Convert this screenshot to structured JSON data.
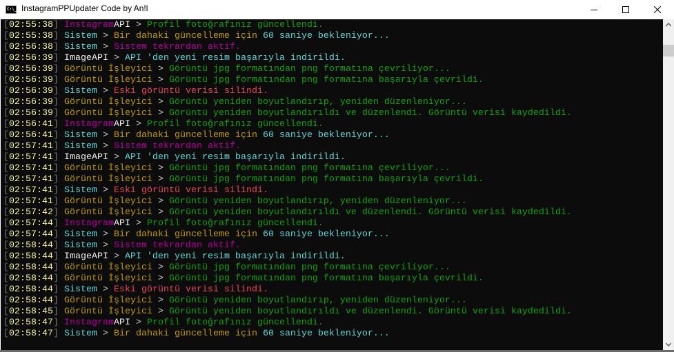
{
  "window": {
    "title": "InstagramPPUpdater Code by An!l",
    "icon_text": "C:\\_"
  },
  "colors": {
    "mag": "#b4009e",
    "wht": "#f2f2f2",
    "gry": "#cccccc",
    "grn": "#13a10e",
    "cyn": "#61d6d6",
    "yel": "#c19c00",
    "red": "#e74856"
  },
  "log": [
    {
      "time": "02:55:38",
      "segs": [
        {
          "text": "Instagram",
          "color": "mag"
        },
        {
          "text": "API",
          "color": "wht"
        },
        {
          "text": " > ",
          "color": "gry"
        },
        {
          "text": "Profil fotoğrafınız güncellendi.",
          "color": "grn"
        }
      ]
    },
    {
      "time": "02:55:38",
      "segs": [
        {
          "text": "Sistem",
          "color": "cyn"
        },
        {
          "text": " > ",
          "color": "gry"
        },
        {
          "text": "Bir dahaki güncelleme için ",
          "color": "yel"
        },
        {
          "text": "60 saniye bekleniyor...",
          "color": "cyn"
        }
      ]
    },
    {
      "time": "02:56:38",
      "segs": [
        {
          "text": "Sistem",
          "color": "cyn"
        },
        {
          "text": " > ",
          "color": "gry"
        },
        {
          "text": "Sistem tekrardan aktif.",
          "color": "mag"
        }
      ]
    },
    {
      "time": "02:56:39",
      "segs": [
        {
          "text": "ImageAPI",
          "color": "wht"
        },
        {
          "text": " > ",
          "color": "gry"
        },
        {
          "text": "API 'den yeni resim başarıyla indirildi.",
          "color": "cyn"
        }
      ]
    },
    {
      "time": "02:56:39",
      "segs": [
        {
          "text": "Görüntü İşleyici",
          "color": "yel"
        },
        {
          "text": " > ",
          "color": "gry"
        },
        {
          "text": "Görüntü jpg formatından png formatına çevriliyor...",
          "color": "grn"
        }
      ]
    },
    {
      "time": "02:56:39",
      "segs": [
        {
          "text": "Görüntü İşleyici",
          "color": "yel"
        },
        {
          "text": " > ",
          "color": "gry"
        },
        {
          "text": "Görüntü jpg formatından png formatına başarıyla çevrildi.",
          "color": "grn"
        }
      ]
    },
    {
      "time": "02:56:39",
      "segs": [
        {
          "text": "Sistem",
          "color": "cyn"
        },
        {
          "text": " > ",
          "color": "gry"
        },
        {
          "text": "Eski görüntü verisi silindi.",
          "color": "red"
        }
      ]
    },
    {
      "time": "02:56:39",
      "segs": [
        {
          "text": "Görüntü İşleyici",
          "color": "yel"
        },
        {
          "text": " > ",
          "color": "gry"
        },
        {
          "text": "Görüntü yeniden boyutlandırıp, yeniden düzenleniyor...",
          "color": "grn"
        }
      ]
    },
    {
      "time": "02:56:39",
      "segs": [
        {
          "text": "Görüntü İşleyici",
          "color": "yel"
        },
        {
          "text": " > ",
          "color": "gry"
        },
        {
          "text": "Görüntü yeniden boyutlandırıldı ve düzenlendi. Görüntü verisi kaydedildi.",
          "color": "grn"
        }
      ]
    },
    {
      "time": "02:56:41",
      "segs": [
        {
          "text": "Instagram",
          "color": "mag"
        },
        {
          "text": "API",
          "color": "wht"
        },
        {
          "text": " > ",
          "color": "gry"
        },
        {
          "text": "Profil fotoğrafınız güncellendi.",
          "color": "grn"
        }
      ]
    },
    {
      "time": "02:56:41",
      "segs": [
        {
          "text": "Sistem",
          "color": "cyn"
        },
        {
          "text": " > ",
          "color": "gry"
        },
        {
          "text": "Bir dahaki güncelleme için ",
          "color": "yel"
        },
        {
          "text": "60 saniye bekleniyor...",
          "color": "cyn"
        }
      ]
    },
    {
      "time": "02:57:41",
      "segs": [
        {
          "text": "Sistem",
          "color": "cyn"
        },
        {
          "text": " > ",
          "color": "gry"
        },
        {
          "text": "Sistem tekrardan aktif.",
          "color": "mag"
        }
      ]
    },
    {
      "time": "02:57:41",
      "segs": [
        {
          "text": "ImageAPI",
          "color": "wht"
        },
        {
          "text": " > ",
          "color": "gry"
        },
        {
          "text": "API 'den yeni resim başarıyla indirildi.",
          "color": "cyn"
        }
      ]
    },
    {
      "time": "02:57:41",
      "segs": [
        {
          "text": "Görüntü İşleyici",
          "color": "yel"
        },
        {
          "text": " > ",
          "color": "gry"
        },
        {
          "text": "Görüntü jpg formatından png formatına çevriliyor...",
          "color": "grn"
        }
      ]
    },
    {
      "time": "02:57:41",
      "segs": [
        {
          "text": "Görüntü İşleyici",
          "color": "yel"
        },
        {
          "text": " > ",
          "color": "gry"
        },
        {
          "text": "Görüntü jpg formatından png formatına başarıyla çevrildi.",
          "color": "grn"
        }
      ]
    },
    {
      "time": "02:57:41",
      "segs": [
        {
          "text": "Sistem",
          "color": "cyn"
        },
        {
          "text": " > ",
          "color": "gry"
        },
        {
          "text": "Eski görüntü verisi silindi.",
          "color": "red"
        }
      ]
    },
    {
      "time": "02:57:41",
      "segs": [
        {
          "text": "Görüntü İşleyici",
          "color": "yel"
        },
        {
          "text": " > ",
          "color": "gry"
        },
        {
          "text": "Görüntü yeniden boyutlandırıp, yeniden düzenleniyor...",
          "color": "grn"
        }
      ]
    },
    {
      "time": "02:57:42",
      "segs": [
        {
          "text": "Görüntü İşleyici",
          "color": "yel"
        },
        {
          "text": " > ",
          "color": "gry"
        },
        {
          "text": "Görüntü yeniden boyutlandırıldı ve düzenlendi. Görüntü verisi kaydedildi.",
          "color": "grn"
        }
      ]
    },
    {
      "time": "02:57:44",
      "segs": [
        {
          "text": "Instagram",
          "color": "mag"
        },
        {
          "text": "API",
          "color": "wht"
        },
        {
          "text": " > ",
          "color": "gry"
        },
        {
          "text": "Profil fotoğrafınız güncellendi.",
          "color": "grn"
        }
      ]
    },
    {
      "time": "02:57:44",
      "segs": [
        {
          "text": "Sistem",
          "color": "cyn"
        },
        {
          "text": " > ",
          "color": "gry"
        },
        {
          "text": "Bir dahaki güncelleme için ",
          "color": "yel"
        },
        {
          "text": "60 saniye bekleniyor...",
          "color": "cyn"
        }
      ]
    },
    {
      "time": "02:58:44",
      "segs": [
        {
          "text": "Sistem",
          "color": "cyn"
        },
        {
          "text": " > ",
          "color": "gry"
        },
        {
          "text": "Sistem tekrardan aktif.",
          "color": "mag"
        }
      ]
    },
    {
      "time": "02:58:44",
      "segs": [
        {
          "text": "ImageAPI",
          "color": "wht"
        },
        {
          "text": " > ",
          "color": "gry"
        },
        {
          "text": "API 'den yeni resim başarıyla indirildi.",
          "color": "cyn"
        }
      ]
    },
    {
      "time": "02:58:44",
      "segs": [
        {
          "text": "Görüntü İşleyici",
          "color": "yel"
        },
        {
          "text": " > ",
          "color": "gry"
        },
        {
          "text": "Görüntü jpg formatından png formatına çevriliyor...",
          "color": "grn"
        }
      ]
    },
    {
      "time": "02:58:44",
      "segs": [
        {
          "text": "Görüntü İşleyici",
          "color": "yel"
        },
        {
          "text": " > ",
          "color": "gry"
        },
        {
          "text": "Görüntü jpg formatından png formatına başarıyla çevrildi.",
          "color": "grn"
        }
      ]
    },
    {
      "time": "02:58:44",
      "segs": [
        {
          "text": "Sistem",
          "color": "cyn"
        },
        {
          "text": " > ",
          "color": "gry"
        },
        {
          "text": "Eski görüntü verisi silindi.",
          "color": "red"
        }
      ]
    },
    {
      "time": "02:58:44",
      "segs": [
        {
          "text": "Görüntü İşleyici",
          "color": "yel"
        },
        {
          "text": " > ",
          "color": "gry"
        },
        {
          "text": "Görüntü yeniden boyutlandırıp, yeniden düzenleniyor...",
          "color": "grn"
        }
      ]
    },
    {
      "time": "02:58:45",
      "segs": [
        {
          "text": "Görüntü İşleyici",
          "color": "yel"
        },
        {
          "text": " > ",
          "color": "gry"
        },
        {
          "text": "Görüntü yeniden boyutlandırıldı ve düzenlendi. Görüntü verisi kaydedildi.",
          "color": "grn"
        }
      ]
    },
    {
      "time": "02:58:47",
      "segs": [
        {
          "text": "Instagram",
          "color": "mag"
        },
        {
          "text": "API",
          "color": "wht"
        },
        {
          "text": " > ",
          "color": "gry"
        },
        {
          "text": "Profil fotoğrafınız güncellendi.",
          "color": "grn"
        }
      ]
    },
    {
      "time": "02:58:47",
      "segs": [
        {
          "text": "Sistem",
          "color": "cyn"
        },
        {
          "text": " > ",
          "color": "gry"
        },
        {
          "text": "Bir dahaki güncelleme için ",
          "color": "yel"
        },
        {
          "text": "60 saniye bekleniyor...",
          "color": "cyn"
        }
      ]
    }
  ]
}
